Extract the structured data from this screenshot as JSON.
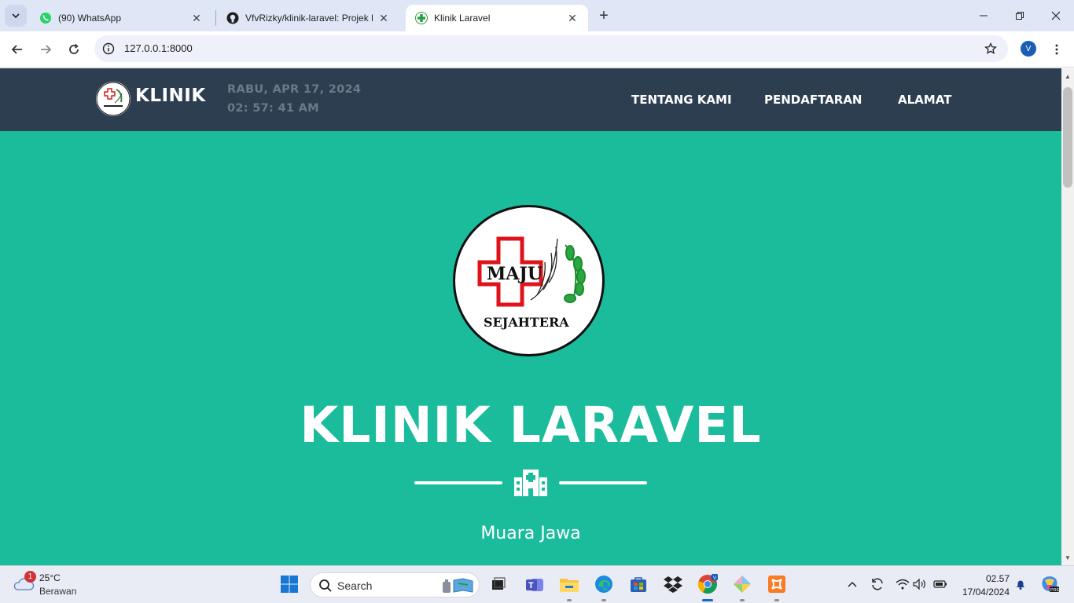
{
  "browser": {
    "tabs": [
      {
        "title": "(90) WhatsApp",
        "favicon": "whatsapp-icon"
      },
      {
        "title": "VfvRizky/klinik-laravel: Projek P",
        "favicon": "github-icon"
      },
      {
        "title": "Klinik Laravel",
        "favicon": "clinic-cross-icon",
        "active": true
      }
    ],
    "url": "127.0.0.1:8000",
    "profile_initial": "V"
  },
  "page": {
    "brand": "KLINIK",
    "date": "RABU, APR 17, 2024",
    "time": "02: 57: 41 AM",
    "nav": [
      "TENTANG KAMI",
      "PENDAFTARAN",
      "ALAMAT"
    ],
    "logo_text_top": "MAJU",
    "logo_text_bottom": "SEJAHTERA",
    "title": "KLINIK LARAVEL",
    "subtitle": "Muara Jawa",
    "colors": {
      "navbar": "#2c3e50",
      "hero": "#1abc9c",
      "datetime": "#6b7a89"
    }
  },
  "taskbar": {
    "weather_temp": "25°C",
    "weather_desc": "Berawan",
    "weather_badge": "1",
    "search_placeholder": "Search",
    "clock_time": "02.57",
    "clock_date": "17/04/2024"
  }
}
